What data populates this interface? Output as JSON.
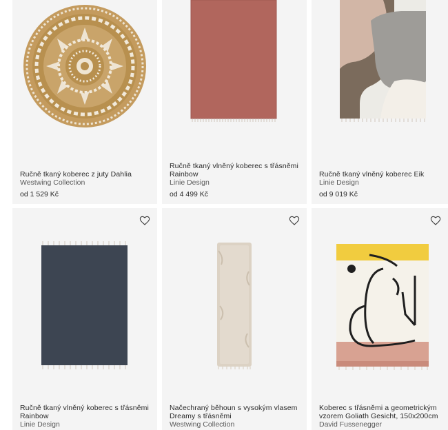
{
  "products": [
    {
      "title": "Ručně tkaný koberec z juty Dahlia",
      "brand": "Westwing Collection",
      "price": "od 1 529 Kč",
      "icon": "heart-outline-icon"
    },
    {
      "title": "Ručně tkaný vlněný koberec s třásněmi Rainbow",
      "brand": "Linie Design",
      "price": "od 4 499 Kč",
      "icon": "heart-outline-icon"
    },
    {
      "title": "Ručně tkaný vlněný koberec Eik",
      "brand": "Linie Design",
      "price": "od 9 019 Kč",
      "icon": "heart-outline-icon"
    },
    {
      "title": "Ručně tkaný vlněný koberec s třásněmi Rainbow",
      "brand": "Linie Design",
      "icon": "heart-outline-icon"
    },
    {
      "title": "Načechraný běhoun s vysokým vlasem Dreamy s třásněmi",
      "brand": "Westwing Collection",
      "icon": "heart-outline-icon"
    },
    {
      "title": "Koberec s třásněmi a geometrickým vzorem Goliath Gesicht, 150x200cm",
      "brand": "David Fussenegger",
      "icon": "heart-outline-icon"
    }
  ],
  "colors": {
    "card_bg": "#f4f4f4",
    "text": "#2b2b2b",
    "brand_text": "#5a5a5a",
    "jute": "#c9a46a",
    "terracotta": "#b3675e",
    "navy": "#3b4350",
    "beige": "#ddd3c5"
  }
}
